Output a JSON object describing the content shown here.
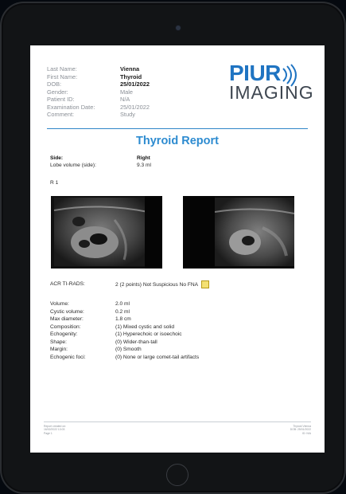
{
  "report": {
    "patient": {
      "last_name_label": "Last Name:",
      "last_name": "Vienna",
      "first_name_label": "First Name:",
      "first_name": "Thyroid",
      "dob_label": "DOB:",
      "dob": "25/01/2022",
      "gender_label": "Gender:",
      "gender": "Male",
      "patient_id_label": "Patient ID:",
      "patient_id": "N/A",
      "exam_date_label": "Examination Date:",
      "exam_date": "25/01/2022",
      "comment_label": "Comment:",
      "comment": "Study"
    },
    "logo": {
      "top": "PIUR",
      "bottom": "IMAGING"
    },
    "title": "Thyroid Report",
    "side": {
      "label": "Side:",
      "value": "Right"
    },
    "lobe_volume": {
      "label": "Lobe volume (side):",
      "value": "9.3 ml"
    },
    "image_label": "R 1",
    "acr": {
      "label": "ACR TI-RADS:",
      "value": "2 (2 points) Not Suspicious No FNA",
      "color": "#f4e173"
    },
    "measurements": [
      {
        "label": "Volume:",
        "value": "2.0 ml"
      },
      {
        "label": "Cystic volume:",
        "value": "0.2 ml"
      },
      {
        "label": "Max diameter:",
        "value": "1.8 cm"
      },
      {
        "label": "Composition:",
        "value": "(1) Mixed cystic and solid"
      },
      {
        "label": "Echogenity:",
        "value": "(1) Hyperechoic or isoechoic"
      },
      {
        "label": "Shape:",
        "value": "(0) Wider-than-tall"
      },
      {
        "label": "Margin:",
        "value": "(0) Smooth"
      },
      {
        "label": "Echogenic foci:",
        "value": "(0) None or large comet-tail artifacts"
      }
    ],
    "footer": {
      "left_line1": "Report created on:",
      "left_line2": "16/02/2022 13:03",
      "left_line3": "Page 1",
      "right_line1": "Thyroid Vienna",
      "right_line2": "DOB: 25/01/2022",
      "right_line3": "ID: N/A"
    }
  },
  "colors": {
    "accent": "#2d8bd0",
    "brand": "#1f74c2"
  }
}
